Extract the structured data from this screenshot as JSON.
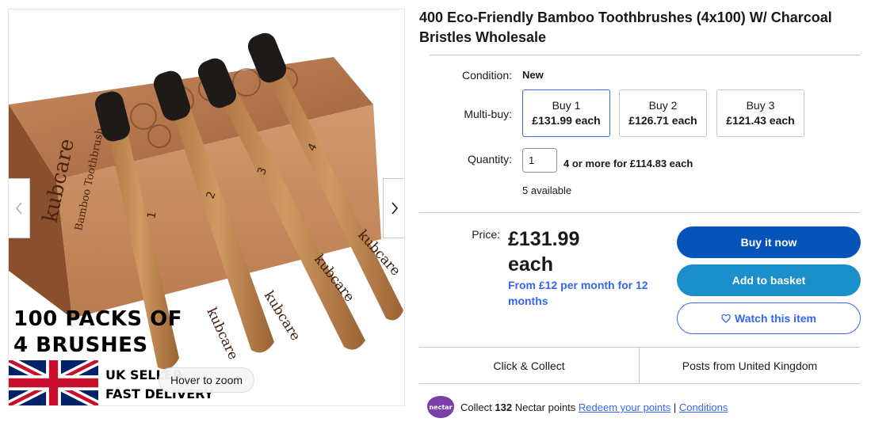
{
  "listing": {
    "title": "400 Eco-Friendly Bamboo Toothbrushes (4x100) W/ Charcoal Bristles Wholesale"
  },
  "gallery": {
    "promo_line_1": "100 PACKS OF",
    "promo_line_2": "4 BRUSHES",
    "seller_line_1": "UK SELLER",
    "seller_line_2": "FAST DELIVERY",
    "zoom_hint": "Hover to zoom",
    "brand_mark": "kubcare",
    "box_label": "Bamboo Toothbrush",
    "brush_numbers": [
      "1",
      "2",
      "3",
      "4"
    ],
    "prev_icon": "chevron-left-icon",
    "next_icon": "chevron-right-icon"
  },
  "condition": {
    "label": "Condition:",
    "value": "New"
  },
  "multibuy": {
    "label": "Multi-buy:",
    "options": [
      {
        "line1": "Buy 1",
        "line2": "£131.99 each",
        "selected": true
      },
      {
        "line1": "Buy 2",
        "line2": "£126.71 each",
        "selected": false
      },
      {
        "line1": "Buy 3",
        "line2": "£121.43 each",
        "selected": false
      }
    ]
  },
  "quantity": {
    "label": "Quantity:",
    "value": "1",
    "bulk_note": "4 or more for £114.83 each",
    "available": "5 available"
  },
  "price": {
    "label": "Price:",
    "amount": "£131.99",
    "unit": "each",
    "finance": "From £12 per month for 12 months"
  },
  "actions": {
    "buy_now": "Buy it now",
    "add_to_basket": "Add to basket",
    "watch": "Watch this item",
    "watch_icon": "heart-icon"
  },
  "delivery": {
    "click_collect": "Click & Collect",
    "posts_from": "Posts from United Kingdom"
  },
  "nectar": {
    "badge": "nectar",
    "collect_prefix": "Collect",
    "points": "132",
    "collect_suffix": "Nectar points",
    "redeem_link": "Redeem your points",
    "separator": "|",
    "conditions_link": "Conditions"
  },
  "colors": {
    "primary_blue": "#0654ba",
    "basket_blue": "#1a8fc9",
    "link_blue": "#3665f3",
    "nectar_purple": "#7b3fa8"
  }
}
